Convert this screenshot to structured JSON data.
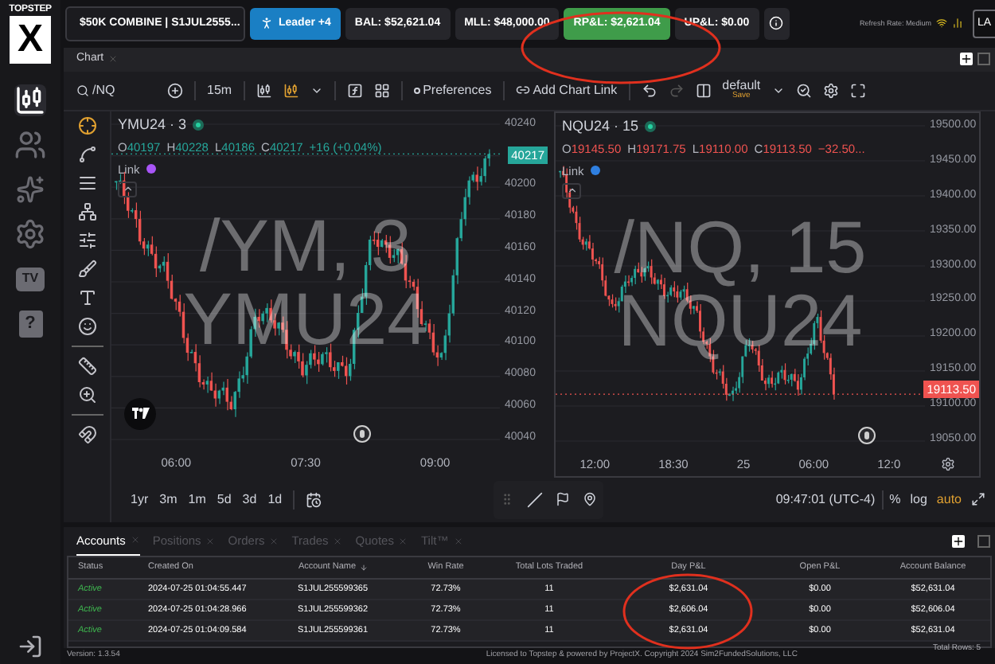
{
  "sidebar": {
    "logo_top": "TOPSTEP",
    "logo_letter": "X",
    "items": [
      {
        "kind": "candles",
        "selected": true
      },
      {
        "kind": "users",
        "selected": false
      },
      {
        "kind": "sparkle",
        "selected": false
      },
      {
        "kind": "settings",
        "selected": false
      },
      {
        "kind": "tv",
        "label": "TV",
        "selected": false
      },
      {
        "kind": "help",
        "label": "?",
        "selected": false
      }
    ]
  },
  "top_bar": {
    "account_select": "$50K COMBINE | S1JUL2555...",
    "leader_button": "Leader +4",
    "stats": [
      {
        "label": "BAL: $52,621.04",
        "kind": "plain"
      },
      {
        "label": "MLL: $48,000.00",
        "kind": "plain"
      },
      {
        "label": "RP&L: $2,621.04",
        "kind": "positive"
      },
      {
        "label": "UP&L: $0.00",
        "kind": "plain"
      }
    ],
    "refresh_rate": "Refresh Rate: Medium",
    "cut_button": "LA"
  },
  "chart_panel": {
    "tab": "Chart",
    "toolbar": {
      "symbol": "/NQ",
      "interval": "15m",
      "preferences": "Preferences",
      "add_chart_link": "Add Chart Link",
      "layout": "default",
      "save": "Save"
    },
    "charts": [
      {
        "title": "YMU24 · 3",
        "color": "#26a69a",
        "ohlc": [
          {
            "key": "O",
            "value": "40197"
          },
          {
            "key": "H",
            "value": "40228"
          },
          {
            "key": "L",
            "value": "40186"
          },
          {
            "key": "C",
            "value": "40217"
          }
        ],
        "change": "+16 (+0.04%)",
        "link": "Link",
        "watermark": [
          "/YM, 3",
          "YMU24"
        ],
        "prices": [
          "40240",
          "40200",
          "40180",
          "40160",
          "40140",
          "40120",
          "40100",
          "40080",
          "40060",
          "40040"
        ],
        "last_price": "40217",
        "times": [
          "06:00",
          "07:30",
          "09:00"
        ]
      },
      {
        "title": "NQU24 · 15",
        "color": "#ef5350",
        "ohlc": [
          {
            "key": "O",
            "value": "19145.50"
          },
          {
            "key": "H",
            "value": "19171.75"
          },
          {
            "key": "L",
            "value": "19110.00"
          },
          {
            "key": "C",
            "value": "19113.50"
          }
        ],
        "change": "−32.50...",
        "link": "Link",
        "watermark": [
          "/NQ, 15",
          "NQU24"
        ],
        "prices": [
          "19500.00",
          "19450.00",
          "19400.00",
          "19350.00",
          "19300.00",
          "19250.00",
          "19200.00",
          "19150.00",
          "19100.00",
          "19050.00"
        ],
        "last_price": "19113.50",
        "times": [
          "12:00",
          "18:30",
          "25",
          "06:00",
          "12:0"
        ]
      }
    ],
    "ranges": [
      "1yr",
      "3m",
      "1m",
      "5d",
      "3d",
      "1d"
    ],
    "clock": "09:47:01 (UTC-4)",
    "percent": "%",
    "log": "log",
    "auto": "auto"
  },
  "bottom_panel": {
    "tabs": [
      {
        "label": "Accounts",
        "selected": true
      },
      {
        "label": "Positions",
        "selected": false
      },
      {
        "label": "Orders",
        "selected": false
      },
      {
        "label": "Trades",
        "selected": false
      },
      {
        "label": "Quotes",
        "selected": false
      },
      {
        "label": "Tilt™",
        "selected": false
      }
    ],
    "columns": [
      "Status",
      "Created On",
      "Account Name",
      "Win Rate",
      "Total Lots Traded",
      "Day P&L",
      "Open P&L",
      "Account Balance"
    ],
    "rows": [
      [
        "Active",
        "2024-07-25 01:04:55.447",
        "S1JUL255599365",
        "72.73%",
        "11",
        "$2,631.04",
        "$0.00",
        "$52,631.04"
      ],
      [
        "Active",
        "2024-07-25 01:04:28.966",
        "S1JUL255599362",
        "72.73%",
        "11",
        "$2,606.04",
        "$0.00",
        "$52,606.04"
      ],
      [
        "Active",
        "2024-07-25 01:04:09.584",
        "S1JUL255599361",
        "72.73%",
        "11",
        "$2,631.04",
        "$0.00",
        "$52,631.04"
      ]
    ],
    "total_rows": "Total Rows: 5"
  },
  "footer": {
    "version": "Version: 1.3.54",
    "license": "Licensed to Topstep & powered by ProjectX. Copyright 2024 Sim2FundedSolutions, LLC"
  }
}
